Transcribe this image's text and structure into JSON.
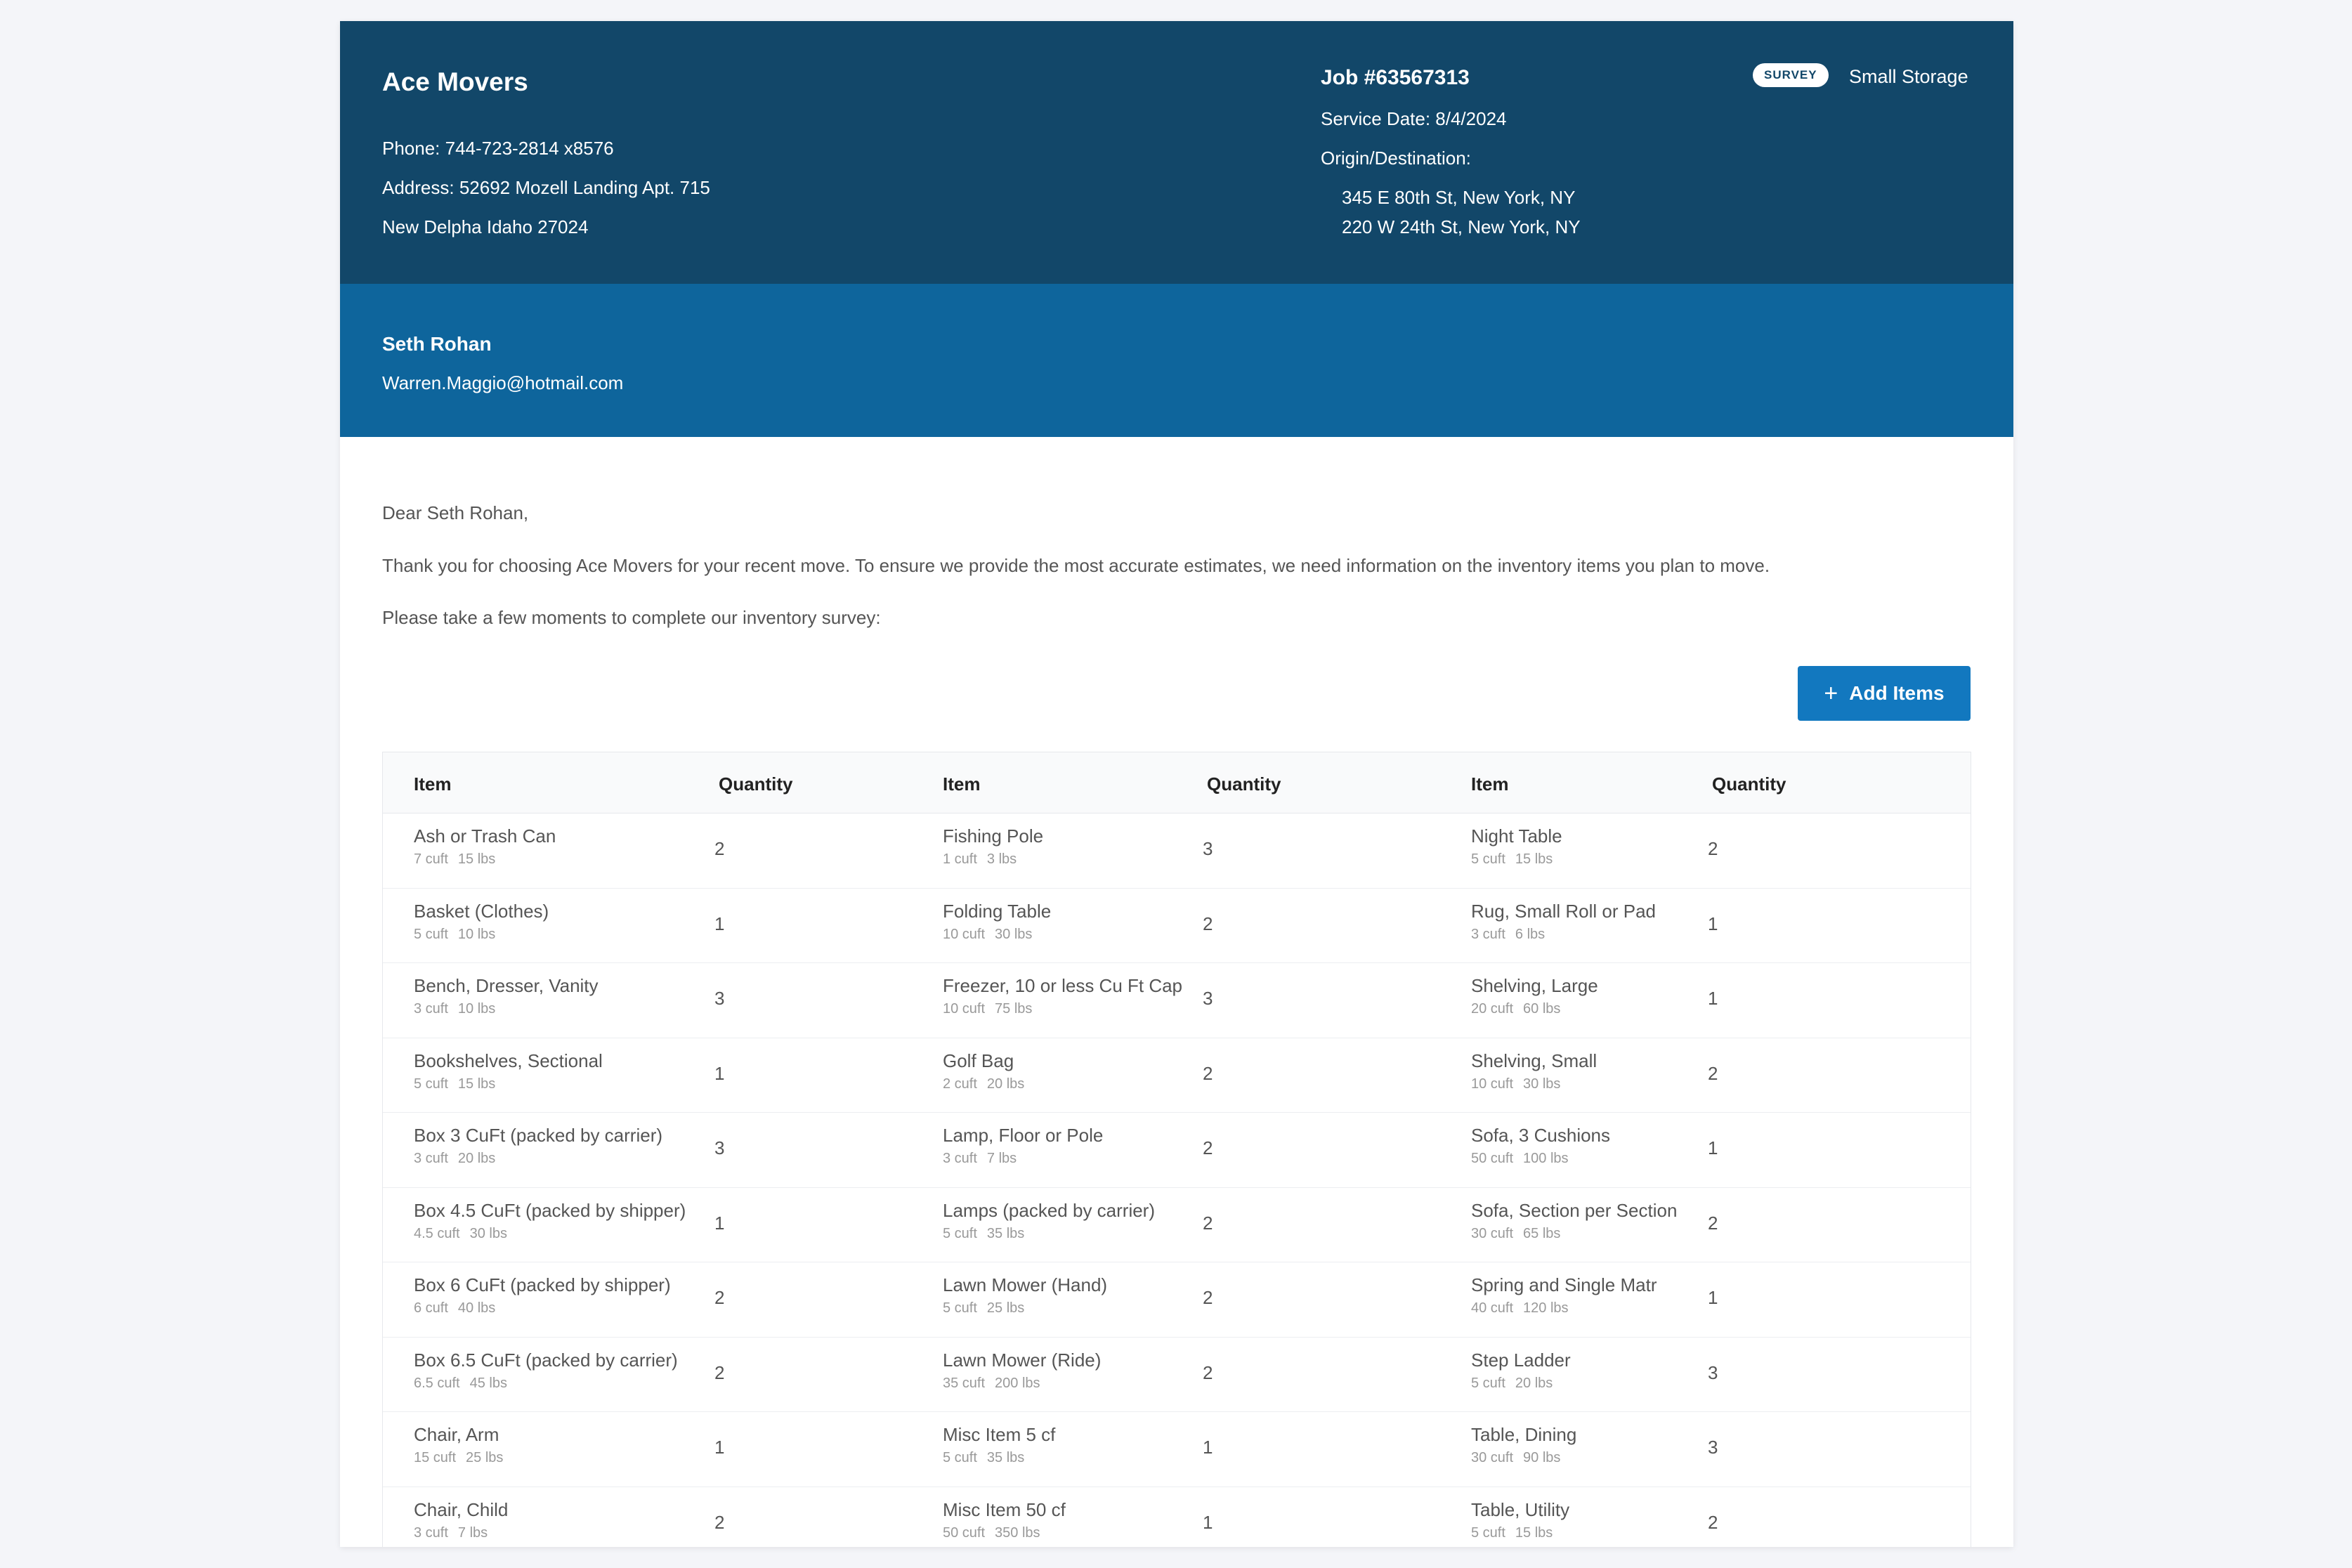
{
  "company": {
    "name": "Ace Movers",
    "phone": "Phone: 744-723-2814 x8576",
    "address1": "Address: 52692 Mozell Landing Apt. 715",
    "address2": "New Delpha Idaho 27024"
  },
  "job": {
    "number": "Job #63567313",
    "service_date": "Service Date: 8/4/2024",
    "origin_label": "Origin/Destination:",
    "origin": "345 E 80th St, New York, NY",
    "destination": "220 W 24th St, New York, NY",
    "badge": "SURVEY",
    "storage": "Small Storage"
  },
  "customer": {
    "name": "Seth Rohan",
    "email": "Warren.Maggio@hotmail.com"
  },
  "letter": {
    "greeting": "Dear Seth Rohan,",
    "body": "Thank you for choosing Ace Movers for your recent move. To ensure we provide the most accurate estimates, we need information on the inventory items you plan to move.",
    "prompt": "Please take a few moments to complete our inventory survey:"
  },
  "add_button": {
    "label": "Add Items",
    "icon": "plus-icon"
  },
  "table": {
    "item_header": "Item",
    "qty_header": "Quantity",
    "columns": [
      [
        {
          "name": "Ash or Trash Can",
          "cuft": "7 cuft",
          "lbs": "15 lbs",
          "qty": "2"
        },
        {
          "name": "Basket (Clothes)",
          "cuft": "5 cuft",
          "lbs": "10 lbs",
          "qty": "1"
        },
        {
          "name": "Bench, Dresser, Vanity",
          "cuft": "3 cuft",
          "lbs": "10 lbs",
          "qty": "3"
        },
        {
          "name": "Bookshelves, Sectional",
          "cuft": "5 cuft",
          "lbs": "15 lbs",
          "qty": "1"
        },
        {
          "name": "Box 3 CuFt (packed by carrier)",
          "cuft": "3 cuft",
          "lbs": "20 lbs",
          "qty": "3"
        },
        {
          "name": "Box 4.5 CuFt (packed by shipper)",
          "cuft": "4.5 cuft",
          "lbs": "30 lbs",
          "qty": "1"
        },
        {
          "name": "Box 6 CuFt (packed by shipper)",
          "cuft": "6 cuft",
          "lbs": "40 lbs",
          "qty": "2"
        },
        {
          "name": "Box 6.5 CuFt (packed by carrier)",
          "cuft": "6.5 cuft",
          "lbs": "45 lbs",
          "qty": "2"
        },
        {
          "name": "Chair, Arm",
          "cuft": "15 cuft",
          "lbs": "25 lbs",
          "qty": "1"
        },
        {
          "name": "Chair, Child",
          "cuft": "3 cuft",
          "lbs": "7 lbs",
          "qty": "2"
        }
      ],
      [
        {
          "name": "Fishing Pole",
          "cuft": "1 cuft",
          "lbs": "3 lbs",
          "qty": "3"
        },
        {
          "name": "Folding Table",
          "cuft": "10 cuft",
          "lbs": "30 lbs",
          "qty": "2"
        },
        {
          "name": "Freezer, 10 or less Cu Ft Cap",
          "cuft": "10 cuft",
          "lbs": "75 lbs",
          "qty": "3"
        },
        {
          "name": "Golf Bag",
          "cuft": "2 cuft",
          "lbs": "20 lbs",
          "qty": "2"
        },
        {
          "name": "Lamp, Floor or Pole",
          "cuft": "3 cuft",
          "lbs": "7 lbs",
          "qty": "2"
        },
        {
          "name": "Lamps (packed by carrier)",
          "cuft": "5 cuft",
          "lbs": "35 lbs",
          "qty": "2"
        },
        {
          "name": "Lawn Mower (Hand)",
          "cuft": "5 cuft",
          "lbs": "25 lbs",
          "qty": "2"
        },
        {
          "name": "Lawn Mower (Ride)",
          "cuft": "35 cuft",
          "lbs": "200 lbs",
          "qty": "2"
        },
        {
          "name": "Misc Item 5 cf",
          "cuft": "5 cuft",
          "lbs": "35 lbs",
          "qty": "1"
        },
        {
          "name": "Misc Item 50 cf",
          "cuft": "50 cuft",
          "lbs": "350 lbs",
          "qty": "1"
        }
      ],
      [
        {
          "name": "Night Table",
          "cuft": "5 cuft",
          "lbs": "15 lbs",
          "qty": "2"
        },
        {
          "name": "Rug, Small Roll or Pad",
          "cuft": "3 cuft",
          "lbs": "6 lbs",
          "qty": "1"
        },
        {
          "name": "Shelving, Large",
          "cuft": "20 cuft",
          "lbs": "60 lbs",
          "qty": "1"
        },
        {
          "name": "Shelving, Small",
          "cuft": "10 cuft",
          "lbs": "30 lbs",
          "qty": "2"
        },
        {
          "name": "Sofa, 3 Cushions",
          "cuft": "50 cuft",
          "lbs": "100 lbs",
          "qty": "1"
        },
        {
          "name": "Sofa, Section per Section",
          "cuft": "30 cuft",
          "lbs": "65 lbs",
          "qty": "2"
        },
        {
          "name": "Spring and Single Matr",
          "cuft": "40 cuft",
          "lbs": "120 lbs",
          "qty": "1"
        },
        {
          "name": "Step Ladder",
          "cuft": "5 cuft",
          "lbs": "20 lbs",
          "qty": "3"
        },
        {
          "name": "Table, Dining",
          "cuft": "30 cuft",
          "lbs": "90 lbs",
          "qty": "3"
        },
        {
          "name": "Table, Utility",
          "cuft": "5 cuft",
          "lbs": "15 lbs",
          "qty": "2"
        }
      ]
    ]
  }
}
